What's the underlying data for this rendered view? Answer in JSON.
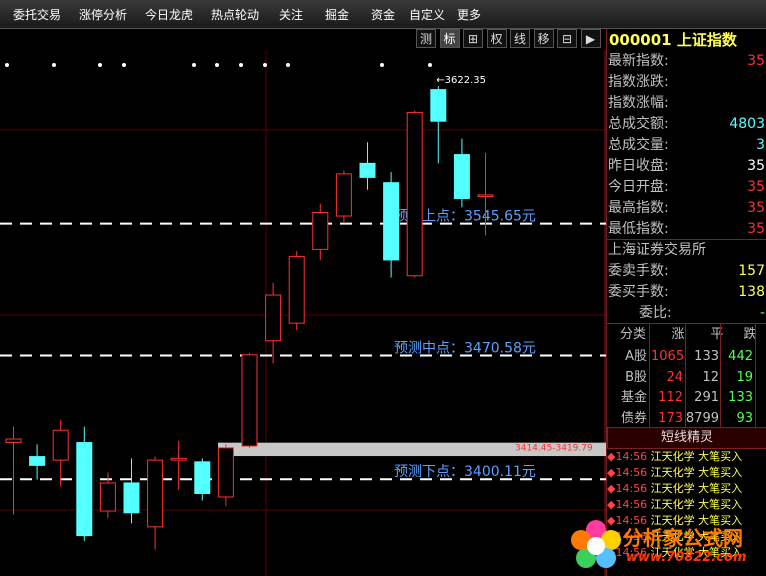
{
  "menu": [
    "委托交易",
    "涨停分析",
    "今日龙虎",
    "热点轮动",
    "关注",
    "掘金",
    "资金",
    "自定义",
    "更多"
  ],
  "toolbar": [
    "测",
    "标",
    "⊞",
    "权",
    "线",
    "移",
    "⊟",
    "▶"
  ],
  "toolbar_active": 1,
  "colors": {
    "up": "#ff3030",
    "down": "#54ffff",
    "label": "#5aa0ff",
    "yellow": "#ffff54",
    "green": "#54ff54"
  },
  "chart": {
    "y_range": [
      3345,
      3640
    ],
    "candles": [
      {
        "o": 3421,
        "c": 3423,
        "h": 3430,
        "l": 3380,
        "dir": "up"
      },
      {
        "o": 3413,
        "c": 3408,
        "h": 3420,
        "l": 3400,
        "dir": "down"
      },
      {
        "o": 3411,
        "c": 3428,
        "h": 3434,
        "l": 3396,
        "dir": "up"
      },
      {
        "o": 3421,
        "c": 3368,
        "h": 3430,
        "l": 3365,
        "dir": "down"
      },
      {
        "o": 3382,
        "c": 3398,
        "h": 3404,
        "l": 3378,
        "dir": "up"
      },
      {
        "o": 3398,
        "c": 3381,
        "h": 3412,
        "l": 3375,
        "dir": "down"
      },
      {
        "o": 3373,
        "c": 3411,
        "h": 3413,
        "l": 3360,
        "dir": "up"
      },
      {
        "o": 3412,
        "c": 3411,
        "h": 3422,
        "l": 3394,
        "dir": "up"
      },
      {
        "o": 3410,
        "c": 3392,
        "h": 3412,
        "l": 3388,
        "dir": "down"
      },
      {
        "o": 3390,
        "c": 3418,
        "h": 3420,
        "l": 3385,
        "dir": "up"
      },
      {
        "o": 3419,
        "c": 3471,
        "h": 3472,
        "l": 3418,
        "dir": "up"
      },
      {
        "o": 3479,
        "c": 3505,
        "h": 3512,
        "l": 3466,
        "dir": "up"
      },
      {
        "o": 3489,
        "c": 3527,
        "h": 3530,
        "l": 3485,
        "dir": "up"
      },
      {
        "o": 3531,
        "c": 3552,
        "h": 3557,
        "l": 3525,
        "dir": "up"
      },
      {
        "o": 3550,
        "c": 3574,
        "h": 3576,
        "l": 3546,
        "dir": "up"
      },
      {
        "o": 3580,
        "c": 3572,
        "h": 3592,
        "l": 3565,
        "dir": "down"
      },
      {
        "o": 3569,
        "c": 3525,
        "h": 3575,
        "l": 3515,
        "dir": "down"
      },
      {
        "o": 3516,
        "c": 3609,
        "h": 3610,
        "l": 3515,
        "dir": "up"
      },
      {
        "o": 3622,
        "c": 3604,
        "h": 3624,
        "l": 3580,
        "dir": "down"
      },
      {
        "o": 3585,
        "c": 3560,
        "h": 3594,
        "l": 3555,
        "dir": "down"
      },
      {
        "o": 3562,
        "c": 3562,
        "h": 3586,
        "l": 3539,
        "dir": "up"
      }
    ],
    "predictions": [
      {
        "label": "预测上点：3545.65元",
        "value": 3545.65
      },
      {
        "label": "预测中点：3470.58元",
        "value": 3470.58
      },
      {
        "label": "预测下点：3400.11元",
        "value": 3400.11
      }
    ],
    "high_marker": "←3622.35",
    "zone_label": "3414.45-3419.79",
    "zone_range": [
      3414.45,
      3419.79
    ]
  },
  "panel": {
    "title": "000001 上证指数",
    "quotes": [
      {
        "label": "最新指数:",
        "value": "35",
        "color": "#ff3030"
      },
      {
        "label": "指数涨跌:",
        "value": "",
        "color": "#ff3030"
      },
      {
        "label": "指数涨幅:",
        "value": "",
        "color": "#ff3030"
      },
      {
        "label": "总成交额:",
        "value": "4803",
        "color": "#54ffff"
      },
      {
        "label": "总成交量:",
        "value": "3",
        "color": "#54ffff"
      },
      {
        "label": "昨日收盘:",
        "value": "35",
        "color": "#ffffff"
      },
      {
        "label": "今日开盘:",
        "value": "35",
        "color": "#ff3030"
      },
      {
        "label": "最高指数:",
        "value": "35",
        "color": "#ff3030"
      },
      {
        "label": "最低指数:",
        "value": "35",
        "color": "#ff3030"
      }
    ],
    "exchange": "上海证券交易所",
    "orders": [
      {
        "label": "委卖手数:",
        "value": "157",
        "color": "#ffff54"
      },
      {
        "label": "委买手数:",
        "value": "138",
        "color": "#ffff54"
      },
      {
        "label": "委比:",
        "value": "-",
        "color": "#54ff54"
      }
    ],
    "class_header": [
      "分类",
      "涨",
      "平",
      "跌"
    ],
    "classes": [
      {
        "name": "A股",
        "up": "1065",
        "flat": "133",
        "down": "442"
      },
      {
        "name": "B股",
        "up": "24",
        "flat": "12",
        "down": "19"
      },
      {
        "name": "基金",
        "up": "112",
        "flat": "291",
        "down": "133"
      },
      {
        "name": "债券",
        "up": "173",
        "flat": "8799",
        "down": "93"
      }
    ],
    "ticks_title": "短线精灵",
    "ticks": [
      {
        "time": "14:56",
        "name": "江天化学",
        "action": "大笔买入"
      },
      {
        "time": "14:56",
        "name": "江天化学",
        "action": "大笔买入"
      },
      {
        "time": "14:56",
        "name": "江天化学",
        "action": "大笔买入"
      },
      {
        "time": "14:56",
        "name": "江天化学",
        "action": "大笔买入"
      },
      {
        "time": "14:56",
        "name": "江天化学",
        "action": "大笔买入"
      },
      {
        "time": "14:56",
        "name": "江天化学",
        "action": "大笔买入"
      },
      {
        "time": "14:56",
        "name": "江天化学",
        "action": "大笔买入"
      }
    ]
  },
  "watermark": {
    "text": "分析家公式网",
    "url": "www.70822.com"
  }
}
